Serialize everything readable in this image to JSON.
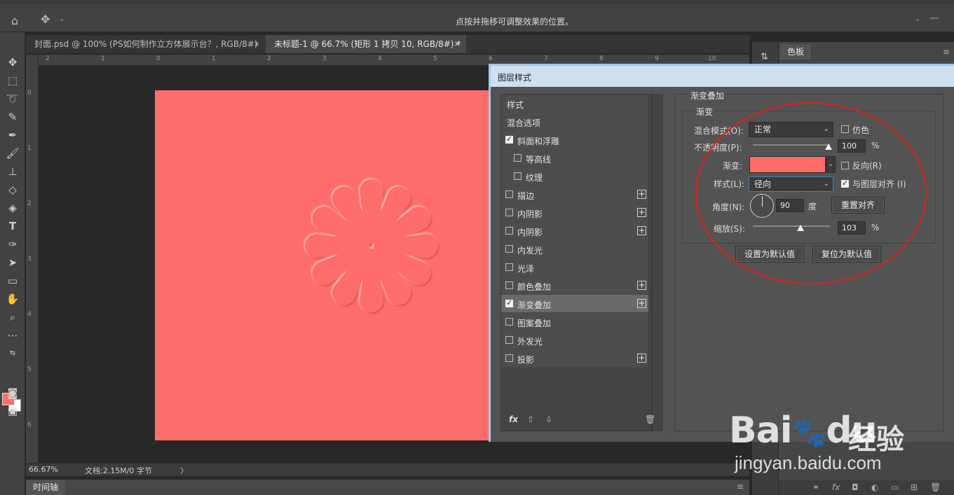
{
  "options_bar": {
    "hint": "点按并拖移可调整效果的位置。"
  },
  "tabs": [
    {
      "label": "封面.psd @ 100% (PS如何制作立方体展示台？, RGB/8#)",
      "close": "×"
    },
    {
      "label": "未标题-1 @ 66.7% (矩形 1 拷贝 10, RGB/8#) *",
      "close": "×"
    }
  ],
  "rulers": {
    "h": [
      "2",
      "1",
      "0",
      "1",
      "2",
      "3",
      "4",
      "5",
      "6",
      "7",
      "8",
      "9",
      "10"
    ],
    "v": [
      "0",
      "1",
      "2",
      "3",
      "4",
      "5",
      "6"
    ]
  },
  "status": {
    "zoom": "66.67%",
    "doc": "文档:2.15M/0 字节",
    "arrow": "〉"
  },
  "timeline": {
    "label": "时间轴"
  },
  "right_panel": {
    "tab": "色板"
  },
  "dialog": {
    "title": "图层样式",
    "styles": [
      {
        "label": "样式",
        "type": "header"
      },
      {
        "label": "混合选项",
        "type": "header"
      },
      {
        "label": "斜面和浮雕",
        "checked": true,
        "plus": false,
        "indent": false
      },
      {
        "label": "等高线",
        "checked": false,
        "plus": false,
        "indent": true
      },
      {
        "label": "纹理",
        "checked": false,
        "plus": false,
        "indent": true
      },
      {
        "label": "描边",
        "checked": false,
        "plus": true,
        "indent": false
      },
      {
        "label": "内阴影",
        "checked": false,
        "plus": true,
        "indent": false
      },
      {
        "label": "内阴影",
        "checked": false,
        "plus": true,
        "indent": false
      },
      {
        "label": "内发光",
        "checked": false,
        "plus": false,
        "indent": false
      },
      {
        "label": "光泽",
        "checked": false,
        "plus": false,
        "indent": false
      },
      {
        "label": "颜色叠加",
        "checked": false,
        "plus": true,
        "indent": false
      },
      {
        "label": "渐变叠加",
        "checked": true,
        "plus": true,
        "indent": false,
        "selected": true
      },
      {
        "label": "图案叠加",
        "checked": false,
        "plus": false,
        "indent": false
      },
      {
        "label": "外发光",
        "checked": false,
        "plus": false,
        "indent": false
      },
      {
        "label": "投影",
        "checked": false,
        "plus": true,
        "indent": false
      }
    ],
    "footer": {
      "fx": "fx",
      "up": "⇧",
      "down": "⇩",
      "trash": "🗑"
    },
    "section_title": "渐变叠加",
    "group_title": "渐变",
    "blend_mode": {
      "label": "混合模式(O):",
      "value": "正常"
    },
    "dither": {
      "label": "仿色",
      "checked": false
    },
    "opacity": {
      "label": "不透明度(P):",
      "value": "100",
      "unit": "%"
    },
    "gradient": {
      "label": "渐变:",
      "color": "#ff6d6a"
    },
    "reverse": {
      "label": "反向(R)",
      "checked": false
    },
    "style": {
      "label": "样式(L):",
      "value": "径向"
    },
    "align": {
      "label": "与图层对齐 (I)",
      "checked": true
    },
    "angle": {
      "label": "角度(N):",
      "value": "90",
      "unit": "度"
    },
    "reset_align": "重置对齐",
    "scale": {
      "label": "缩放(S):",
      "value": "103",
      "unit": "%"
    },
    "set_default": "设置为默认值",
    "reset_default": "复位为默认值"
  },
  "watermark": {
    "brand": "Bai",
    "brand2": "du",
    "jingyan": "经验",
    "url": "jingyan.baidu.com"
  },
  "colors": {
    "doc_fill": "#ff6d6a",
    "annotation": "#e0201a"
  }
}
